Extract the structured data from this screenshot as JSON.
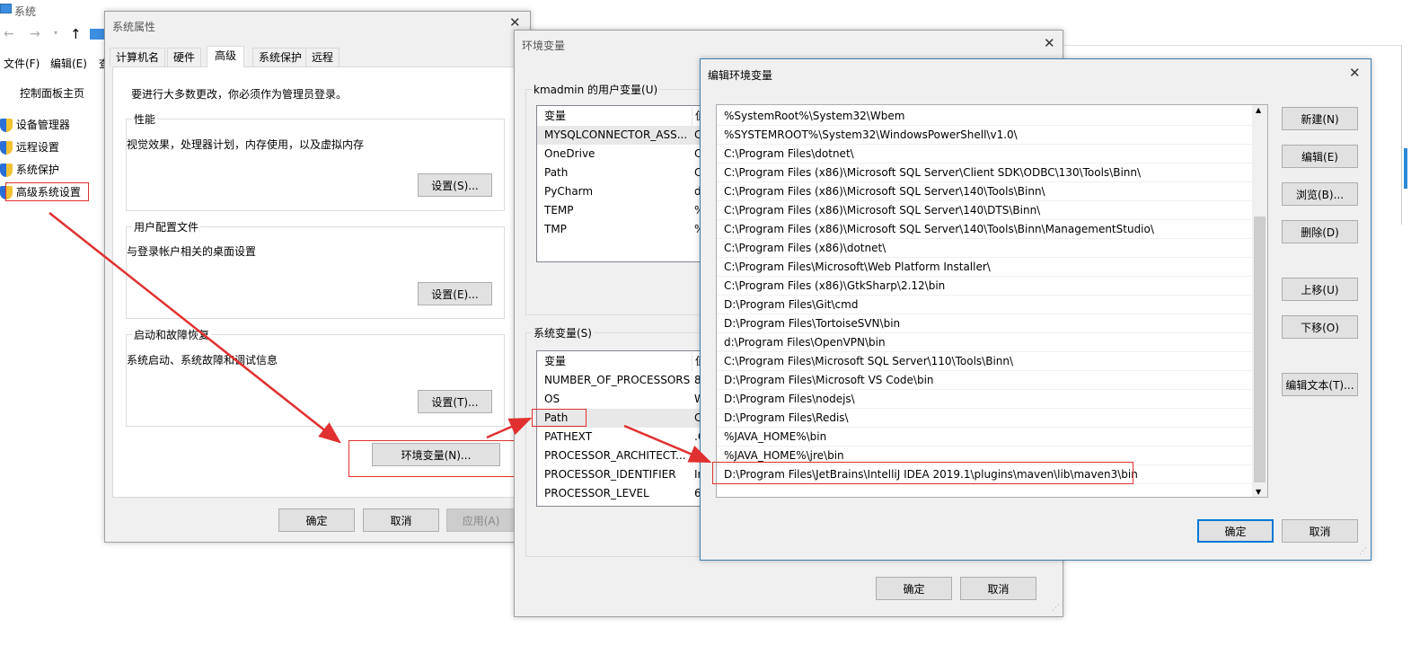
{
  "explorer": {
    "title": "系统",
    "menu": [
      "文件(F)",
      "编辑(E)",
      "查"
    ],
    "sidebar": [
      "控制面板主页",
      "设备管理器",
      "远程设置",
      "系统保护",
      "高级系统设置"
    ]
  },
  "sysprops": {
    "title": "系统属性",
    "tabs": [
      "计算机名",
      "硬件",
      "高级",
      "系统保护",
      "远程"
    ],
    "active_tab": "高级",
    "admin_note": "要进行大多数更改，你必须作为管理员登录。",
    "perf": {
      "label": "性能",
      "desc": "视觉效果，处理器计划，内存使用，以及虚拟内存",
      "button": "设置(S)..."
    },
    "profile": {
      "label": "用户配置文件",
      "desc": "与登录帐户相关的桌面设置",
      "button": "设置(E)..."
    },
    "startup": {
      "label": "启动和故障恢复",
      "desc": "系统启动、系统故障和调试信息",
      "button": "设置(T)..."
    },
    "env_button": "环境变量(N)...",
    "ok": "确定",
    "cancel": "取消",
    "apply": "应用(A)"
  },
  "envvars": {
    "title": "环境变量",
    "user_label": "kmadmin 的用户变量(U)",
    "sys_label": "系统变量(S)",
    "col_var": "变量",
    "col_val": "值",
    "user_vars": [
      [
        "MYSQLCONNECTOR_ASS...",
        "C"
      ],
      [
        "OneDrive",
        "C"
      ],
      [
        "Path",
        "C"
      ],
      [
        "PyCharm",
        "d"
      ],
      [
        "TEMP",
        "%"
      ],
      [
        "TMP",
        "%"
      ]
    ],
    "sys_vars": [
      [
        "NUMBER_OF_PROCESSORS",
        "8"
      ],
      [
        "OS",
        "W"
      ],
      [
        "Path",
        "C"
      ],
      [
        "PATHEXT",
        ".C"
      ],
      [
        "PROCESSOR_ARCHITECT...",
        "A"
      ],
      [
        "PROCESSOR_IDENTIFIER",
        "In"
      ],
      [
        "PROCESSOR_LEVEL",
        "6"
      ]
    ],
    "ok": "确定",
    "cancel": "取消"
  },
  "editenv": {
    "title": "编辑环境变量",
    "entries": [
      "%SystemRoot%\\System32\\Wbem",
      "%SYSTEMROOT%\\System32\\WindowsPowerShell\\v1.0\\",
      "C:\\Program Files\\dotnet\\",
      "C:\\Program Files (x86)\\Microsoft SQL Server\\Client SDK\\ODBC\\130\\Tools\\Binn\\",
      "C:\\Program Files (x86)\\Microsoft SQL Server\\140\\Tools\\Binn\\",
      "C:\\Program Files (x86)\\Microsoft SQL Server\\140\\DTS\\Binn\\",
      "C:\\Program Files (x86)\\Microsoft SQL Server\\140\\Tools\\Binn\\ManagementStudio\\",
      "C:\\Program Files (x86)\\dotnet\\",
      "C:\\Program Files\\Microsoft\\Web Platform Installer\\",
      "C:\\Program Files (x86)\\GtkSharp\\2.12\\bin",
      "D:\\Program Files\\Git\\cmd",
      "D:\\Program Files\\TortoiseSVN\\bin",
      "d:\\Program Files\\OpenVPN\\bin",
      "C:\\Program Files\\Microsoft SQL Server\\110\\Tools\\Binn\\",
      "D:\\Program Files\\Microsoft VS Code\\bin",
      "D:\\Program Files\\nodejs\\",
      "D:\\Program Files\\Redis\\",
      "%JAVA_HOME%\\bin",
      "%JAVA_HOME%\\jre\\bin",
      "D:\\Program Files\\JetBrains\\IntelliJ IDEA 2019.1\\plugins\\maven\\lib\\maven3\\bin"
    ],
    "buttons": {
      "new": "新建(N)",
      "edit": "编辑(E)",
      "browse": "浏览(B)...",
      "delete": "删除(D)",
      "up": "上移(U)",
      "down": "下移(O)",
      "edit_text": "编辑文本(T)..."
    },
    "ok": "确定",
    "cancel": "取消"
  },
  "annotation_color": "#e03030"
}
